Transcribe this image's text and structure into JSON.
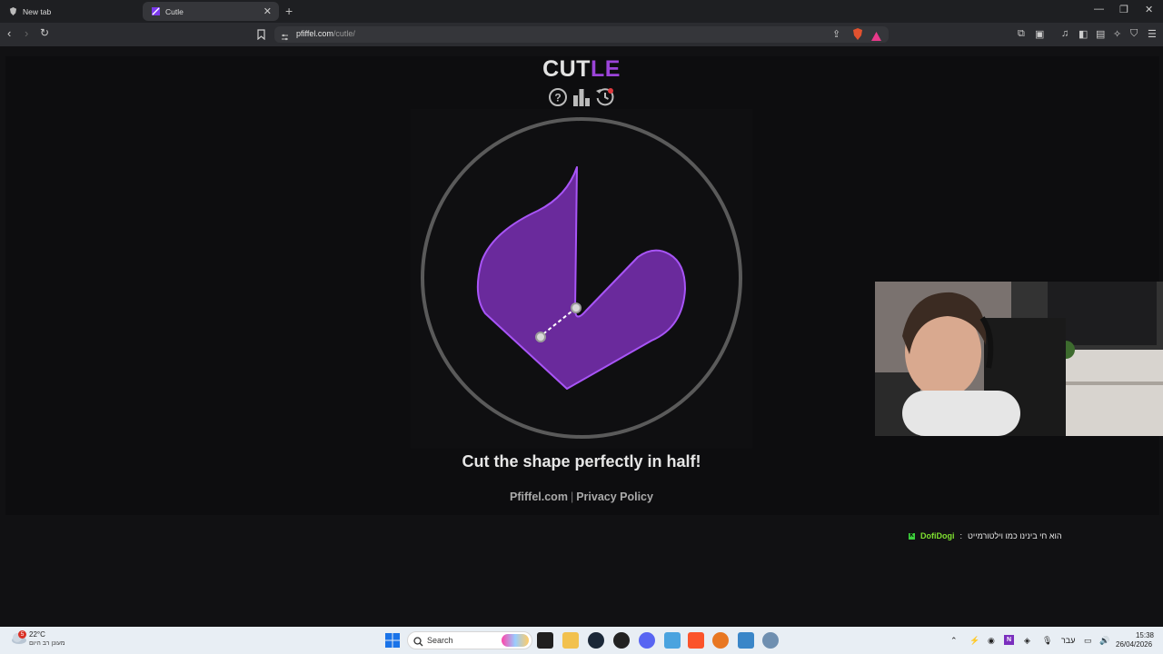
{
  "browser": {
    "tabs": [
      {
        "title": "New tab",
        "active": false
      },
      {
        "title": "Cutle",
        "active": true
      }
    ],
    "url_host": "pfiffel.com",
    "url_path": "/cutle/"
  },
  "game": {
    "title_part1": "CUT",
    "title_part2": "LE",
    "header_icons": [
      "help-icon",
      "stats-icon",
      "history-icon"
    ],
    "instruction": "Cut the shape perfectly in half!",
    "footer_link1": "Pfiffel.com",
    "footer_sep": "|",
    "footer_link2": "Privacy Policy",
    "shape_color": "#6a2a9c",
    "shape_stroke": "#a855f7",
    "ring_color": "#5a5a5a"
  },
  "chat": {
    "user": "DofiDogi",
    "sep": ":",
    "message": "הוא חי בינינו כמו וילטורמייט"
  },
  "taskbar": {
    "weather_temp": "22°C",
    "weather_desc": "מעונן רב היום",
    "weather_badge": "5",
    "search_label": "Search",
    "lang": "עבר",
    "time": "15:38",
    "date": "26/04/2026"
  }
}
